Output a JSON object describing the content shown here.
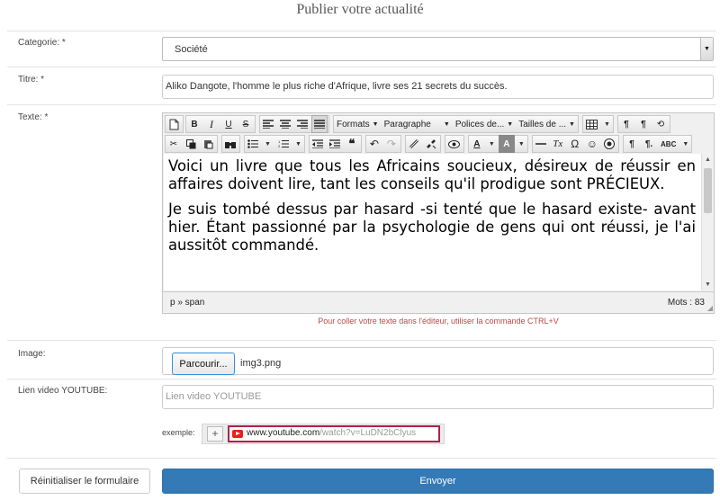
{
  "page": {
    "title": "Publier votre actualité"
  },
  "form": {
    "category": {
      "label": "Categorie: *",
      "value": "Société"
    },
    "title": {
      "label": "Titre: *",
      "value": "Aliko Dangote, l'homme le plus riche d'Afrique, livre ses 21 secrets du succès."
    },
    "text": {
      "label": "Texte: *",
      "paragraphs": [
        "Voici un livre que tous les Africains soucieux, désireux de réussir en affaires doivent lire, tant les conseils qu'il prodigue sont PRÉCIEUX.",
        "Je suis tombé dessus par hasard -si tenté que le hasard existe- avant hier. Étant passionné par la psychologie de gens qui ont réussi, je l'ai aussitôt commandé."
      ],
      "status_path": "p » span",
      "word_count": "Mots : 83"
    },
    "hint": "Pour coller votre texte dans l'éditeur, utiliser la commande CTRL+V",
    "image": {
      "label": "Image:",
      "button": "Parcourir...",
      "file": "img3.png"
    },
    "youtube": {
      "label": "Lien video YOUTUBE:",
      "placeholder": "Lien video YOUTUBE",
      "example_label": "exemple:",
      "example_domain": "www.youtube.com",
      "example_path": "/watch?v=LuDN2bClyus"
    },
    "reset_label": "Réinitialiser le formulaire",
    "submit_label": "Envoyer"
  },
  "toolbar": {
    "formats": "Formats",
    "paragraph": "Paragraphe",
    "fonts": "Polices de...",
    "sizes": "Tailles de ..."
  }
}
